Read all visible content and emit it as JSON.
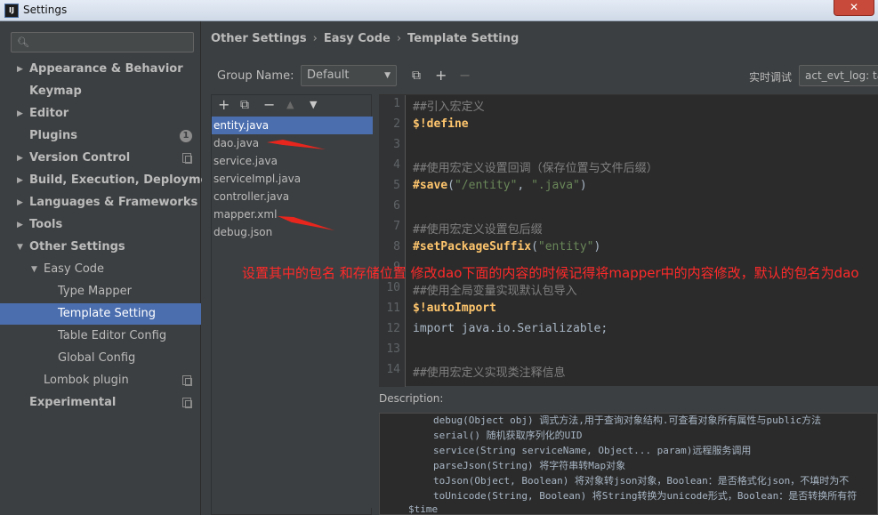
{
  "window": {
    "title": "Settings",
    "app_icon_text": "IJ",
    "close_label": "✕"
  },
  "sidebar": {
    "search_placeholder": "",
    "items": [
      {
        "label": "Appearance & Behavior",
        "arrow": "▶",
        "bold": true
      },
      {
        "label": "Keymap",
        "bold": true
      },
      {
        "label": "Editor",
        "arrow": "▶",
        "bold": true
      },
      {
        "label": "Plugins",
        "bold": true,
        "badge": "1"
      },
      {
        "label": "Version Control",
        "arrow": "▶",
        "bold": true
      },
      {
        "label": "Build, Execution, Deployment",
        "arrow": "▶",
        "bold": true
      },
      {
        "label": "Languages & Frameworks",
        "arrow": "▶",
        "bold": true
      },
      {
        "label": "Tools",
        "arrow": "▶",
        "bold": true
      },
      {
        "label": "Other Settings",
        "arrow": "▼",
        "bold": true
      },
      {
        "label": "Easy Code",
        "arrow": "▼"
      },
      {
        "label": "Type Mapper"
      },
      {
        "label": "Template Setting",
        "selected": true
      },
      {
        "label": "Table Editor Config"
      },
      {
        "label": "Global Config"
      },
      {
        "label": "Lombok plugin"
      },
      {
        "label": "Experimental",
        "bold": true
      }
    ]
  },
  "breadcrumb": [
    "Other Settings",
    "Easy Code",
    "Template Setting"
  ],
  "breadcrumb_sep": "›",
  "group": {
    "label": "Group Name:",
    "value": "Default"
  },
  "realtime": {
    "label": "实时调试",
    "value": "act_evt_log: ta"
  },
  "files": [
    "entity.java",
    "dao.java",
    "service.java",
    "serviceImpl.java",
    "controller.java",
    "mapper.xml",
    "debug.json"
  ],
  "selected_file": "entity.java",
  "code": {
    "line_numbers": [
      "1",
      "2",
      "3",
      "4",
      "5",
      "6",
      "7",
      "8",
      "9",
      "10",
      "11",
      "12",
      "13",
      "14"
    ],
    "l1": "##引入宏定义",
    "l2": "$!define",
    "l4": "##使用宏定义设置回调（保存位置与文件后缀）",
    "l5_macro": "#save",
    "l5_open": "(",
    "l5_s1": "\"/entity\"",
    "l5_comma": ", ",
    "l5_s2": "\".java\"",
    "l5_close": ")",
    "l7": "##使用宏定义设置包后缀",
    "l8_macro": "#setPackageSuffix",
    "l8_open": "(",
    "l8_s1": "\"entity\"",
    "l8_close": ")",
    "l10": "##使用全局变量实现默认包导入",
    "l11": "$!autoImport",
    "l12": "import java.io.Serializable;",
    "l14": "##使用宏定义实现类注释信息"
  },
  "annotation": "设置其中的包名 和存储位置  修改dao下面的内容的时候记得将mapper中的内容修改，默认的包名为dao",
  "description": {
    "label": "Description:",
    "lines": [
      "debug(Object obj) 调式方法,用于查询对象结构.可查看对象所有属性与public方法",
      "serial() 随机获取序列化的UID",
      "service(String serviceName, Object... param)远程服务调用",
      "parseJson(String) 将字符串转Map对象",
      "toJson(Object, Boolean) 将对象转json对象，Boolean：是否格式化json，不填时为不",
      "toUnicode(String, Boolean) 将String转换为unicode形式，Boolean：是否转换所有符"
    ],
    "last": "$time"
  },
  "colors": {
    "selection": "#4b6eaf",
    "annotation": "#ff2a2a",
    "background": "#3c3f41",
    "editor_bg": "#2b2b2b"
  }
}
